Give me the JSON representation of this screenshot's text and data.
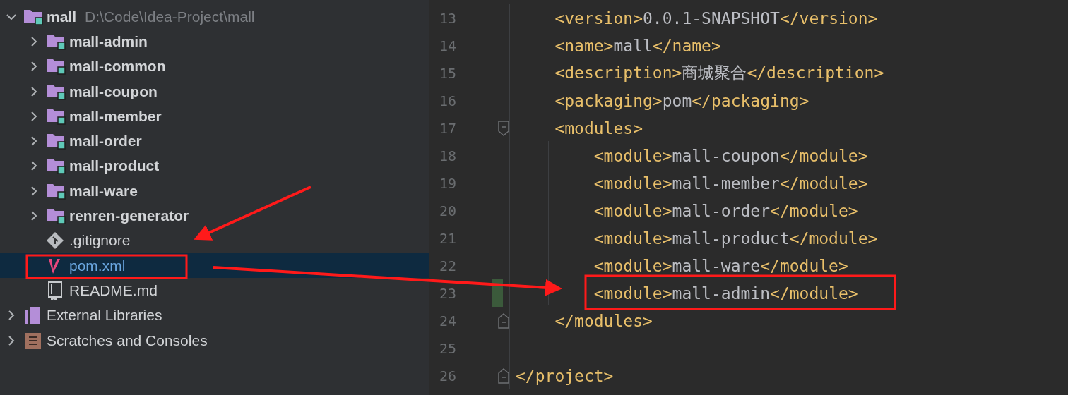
{
  "project_tree": [
    {
      "label": "mall",
      "path": "D:\\Code\\Idea-Project\\mall",
      "kind": "module",
      "expanded": true,
      "selected": false,
      "children": [
        {
          "label": "mall-admin",
          "kind": "module",
          "expanded": false,
          "selected": false
        },
        {
          "label": "mall-common",
          "kind": "module",
          "expanded": false,
          "selected": false
        },
        {
          "label": "mall-coupon",
          "kind": "module",
          "expanded": false,
          "selected": false
        },
        {
          "label": "mall-member",
          "kind": "module",
          "expanded": false,
          "selected": false
        },
        {
          "label": "mall-order",
          "kind": "module",
          "expanded": false,
          "selected": false
        },
        {
          "label": "mall-product",
          "kind": "module",
          "expanded": false,
          "selected": false
        },
        {
          "label": "mall-ware",
          "kind": "module",
          "expanded": false,
          "selected": false
        },
        {
          "label": "renren-generator",
          "kind": "module",
          "expanded": false,
          "selected": false
        },
        {
          "label": ".gitignore",
          "kind": "git",
          "selected": false
        },
        {
          "label": "pom.xml",
          "kind": "maven",
          "selected": true
        },
        {
          "label": "README.md",
          "kind": "markdown",
          "selected": false
        }
      ]
    },
    {
      "label": "External Libraries",
      "kind": "libraries",
      "expanded": false,
      "selected": false
    },
    {
      "label": "Scratches and Consoles",
      "kind": "scratches",
      "expanded": false,
      "selected": false
    }
  ],
  "editor": {
    "lines": [
      {
        "number": "13",
        "changed": false,
        "fold_start": false,
        "fold_end": false,
        "tokens": [
          {
            "kind": "tag",
            "text": "    <version>"
          },
          {
            "kind": "text",
            "text": "0.0.1-SNAPSHOT"
          },
          {
            "kind": "tag",
            "text": "</version>"
          }
        ]
      },
      {
        "number": "14",
        "changed": false,
        "fold_start": false,
        "fold_end": false,
        "tokens": [
          {
            "kind": "tag",
            "text": "    <name>"
          },
          {
            "kind": "text",
            "text": "mall"
          },
          {
            "kind": "tag",
            "text": "</name>"
          }
        ]
      },
      {
        "number": "15",
        "changed": false,
        "fold_start": false,
        "fold_end": false,
        "tokens": [
          {
            "kind": "tag",
            "text": "    <description>"
          },
          {
            "kind": "text",
            "text": "商城聚合"
          },
          {
            "kind": "tag",
            "text": "</description>"
          }
        ]
      },
      {
        "number": "16",
        "changed": false,
        "fold_start": false,
        "fold_end": false,
        "tokens": [
          {
            "kind": "tag",
            "text": "    <packaging>"
          },
          {
            "kind": "text",
            "text": "pom"
          },
          {
            "kind": "tag",
            "text": "</packaging>"
          }
        ]
      },
      {
        "number": "17",
        "changed": false,
        "fold_start": true,
        "fold_end": false,
        "tokens": [
          {
            "kind": "tag",
            "text": "    <modules>"
          }
        ]
      },
      {
        "number": "18",
        "changed": false,
        "fold_start": false,
        "fold_end": false,
        "tokens": [
          {
            "kind": "tag",
            "text": "        <module>"
          },
          {
            "kind": "text",
            "text": "mall-coupon"
          },
          {
            "kind": "tag",
            "text": "</module>"
          }
        ]
      },
      {
        "number": "19",
        "changed": false,
        "fold_start": false,
        "fold_end": false,
        "tokens": [
          {
            "kind": "tag",
            "text": "        <module>"
          },
          {
            "kind": "text",
            "text": "mall-member"
          },
          {
            "kind": "tag",
            "text": "</module>"
          }
        ]
      },
      {
        "number": "20",
        "changed": false,
        "fold_start": false,
        "fold_end": false,
        "tokens": [
          {
            "kind": "tag",
            "text": "        <module>"
          },
          {
            "kind": "text",
            "text": "mall-order"
          },
          {
            "kind": "tag",
            "text": "</module>"
          }
        ]
      },
      {
        "number": "21",
        "changed": false,
        "fold_start": false,
        "fold_end": false,
        "tokens": [
          {
            "kind": "tag",
            "text": "        <module>"
          },
          {
            "kind": "text",
            "text": "mall-product"
          },
          {
            "kind": "tag",
            "text": "</module>"
          }
        ]
      },
      {
        "number": "22",
        "changed": false,
        "fold_start": false,
        "fold_end": false,
        "tokens": [
          {
            "kind": "tag",
            "text": "        <module>"
          },
          {
            "kind": "text",
            "text": "mall-ware"
          },
          {
            "kind": "tag",
            "text": "</module>"
          }
        ]
      },
      {
        "number": "23",
        "changed": true,
        "fold_start": false,
        "fold_end": false,
        "tokens": [
          {
            "kind": "tag",
            "text": "        <module>"
          },
          {
            "kind": "text",
            "text": "mall-admin"
          },
          {
            "kind": "tag",
            "text": "</module>"
          }
        ]
      },
      {
        "number": "24",
        "changed": false,
        "fold_start": false,
        "fold_end": true,
        "tokens": [
          {
            "kind": "tag",
            "text": "    </modules>"
          }
        ]
      },
      {
        "number": "25",
        "changed": false,
        "fold_start": false,
        "fold_end": false
      },
      {
        "number": "26",
        "changed": false,
        "fold_start": false,
        "fold_end": true,
        "tokens": [
          {
            "kind": "tag",
            "text": "</project>"
          }
        ]
      }
    ]
  }
}
